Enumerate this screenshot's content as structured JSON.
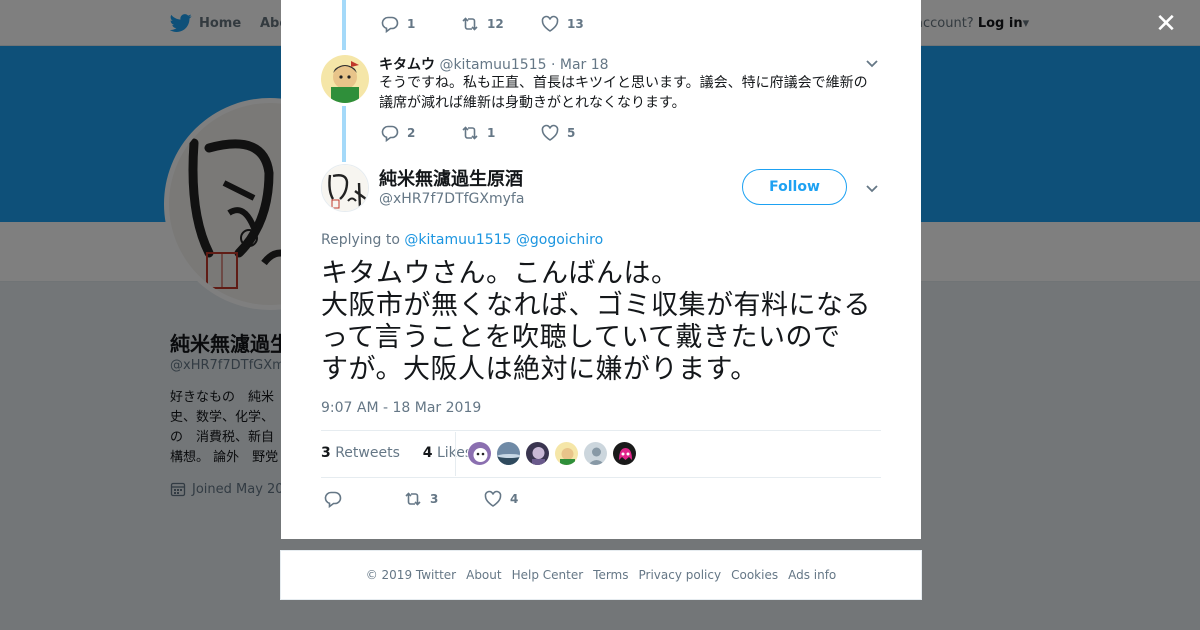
{
  "nav": {
    "home_label": "Home",
    "about_label": "Abo",
    "login_prompt": "account?",
    "login_label": "Log in"
  },
  "profile": {
    "name": "純米無濾過生",
    "handle": "@xHR7f7DTfGXm",
    "bio_lines": [
      "好きなもの　純米",
      "史、数学、化学、",
      "の　消費税、新自",
      "構想。 論外　野党"
    ],
    "joined": "Joined May 20"
  },
  "prev_tweet_stats": {
    "replies": "1",
    "retweets": "12",
    "likes": "13"
  },
  "reply": {
    "name": "キタムウ",
    "handle": "@kitamuu1515",
    "date": "· Mar 18",
    "text": "そうですね。私も正直、首長はキツイと思います。議会、特に府議会で維新の議席が減れば維新は身動きがとれなくなります。",
    "replies": "2",
    "retweets": "1",
    "likes": "5"
  },
  "main_tweet": {
    "name": "純米無濾過生原酒",
    "handle": "@xHR7f7DTfGXmyfa",
    "follow_label": "Follow",
    "replying_to_label": "Replying to",
    "mention_1": "@kitamuu1515",
    "mention_2": "@gogoichiro",
    "text_lines": [
      "キタムウさん。こんばんは。",
      "大阪市が無くなれば、ゴミ収集が有料になる",
      "って言うことを吹聴していて戴きたいので",
      "すが。大阪人は絶対に嫌がります。"
    ],
    "timestamp": "9:07 AM - 18 Mar 2019",
    "retweet_count": "3",
    "retweets_label": "Retweets",
    "like_count": "4",
    "likes_label": "Likes",
    "action_retweets": "3",
    "action_likes": "4"
  },
  "footer": {
    "items": [
      "© 2019 Twitter",
      "About",
      "Help Center",
      "Terms",
      "Privacy policy",
      "Cookies",
      "Ads info"
    ]
  },
  "colors": {
    "brand": "#1da1f2",
    "link": "#1b95e0",
    "thread": "#a4d9f9"
  }
}
